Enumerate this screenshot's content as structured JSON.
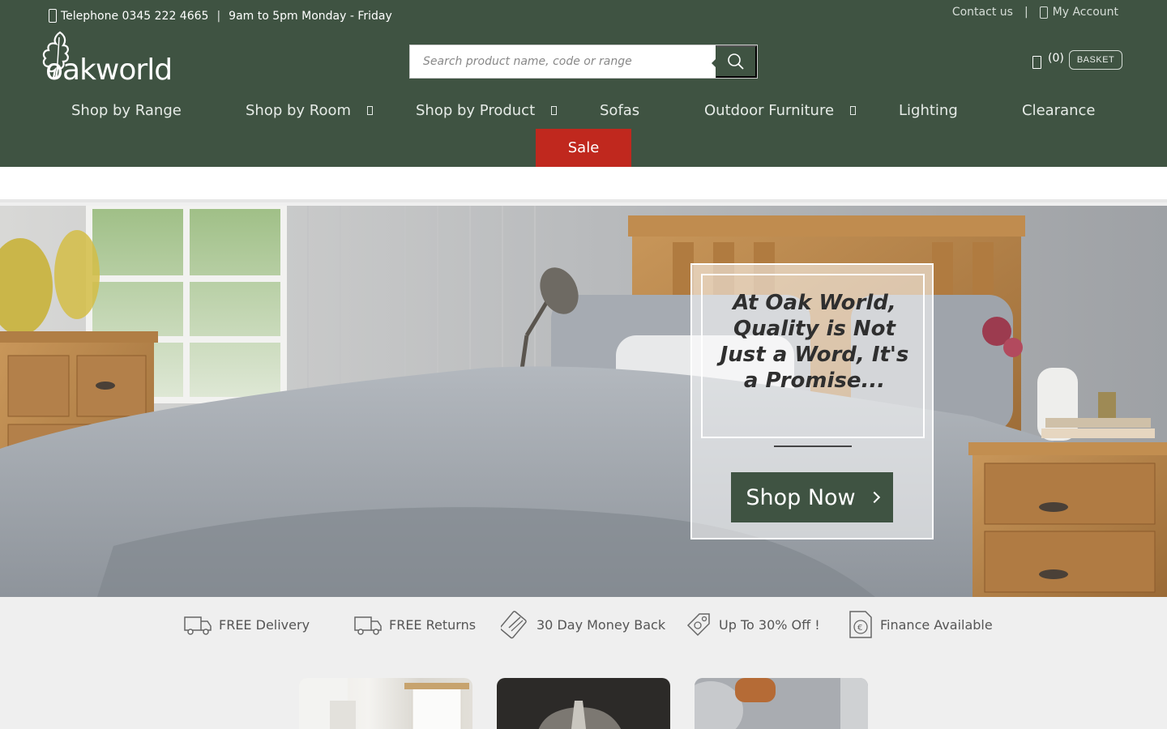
{
  "topbar": {
    "phone_text": "Telephone 0345 222 4665",
    "separator": "|",
    "hours": "9am to 5pm Monday - Friday",
    "contact": "Contact us",
    "account": "My Account"
  },
  "logo": {
    "text": "oakworld"
  },
  "search": {
    "placeholder": "Search product name, code or range",
    "value": ""
  },
  "basket": {
    "count": "(0)",
    "label": "BASKET"
  },
  "nav": {
    "items": [
      {
        "label": "Shop by Range",
        "has_dropdown": false
      },
      {
        "label": "Shop by Room",
        "has_dropdown": true
      },
      {
        "label": "Shop by Product",
        "has_dropdown": true
      },
      {
        "label": "Sofas",
        "has_dropdown": false
      },
      {
        "label": "Outdoor Furniture",
        "has_dropdown": true
      },
      {
        "label": "Lighting",
        "has_dropdown": false
      },
      {
        "label": "Clearance",
        "has_dropdown": false
      }
    ],
    "sale": "Sale"
  },
  "hero": {
    "title": "At Oak World, Quality is Not Just a Word, It's a Promise...",
    "cta": "Shop Now"
  },
  "usps": [
    {
      "icon": "truck-icon",
      "label": "FREE Delivery"
    },
    {
      "icon": "truck-icon",
      "label": "FREE Returns"
    },
    {
      "icon": "card-icon",
      "label": "30 Day Money Back"
    },
    {
      "icon": "price-tag-icon",
      "label": "Up To 30% Off !"
    },
    {
      "icon": "finance-icon",
      "label": "Finance Available"
    }
  ],
  "colors": {
    "brand_green": "#3f5342",
    "sale_red": "#c0281e",
    "background": "#efefef"
  }
}
